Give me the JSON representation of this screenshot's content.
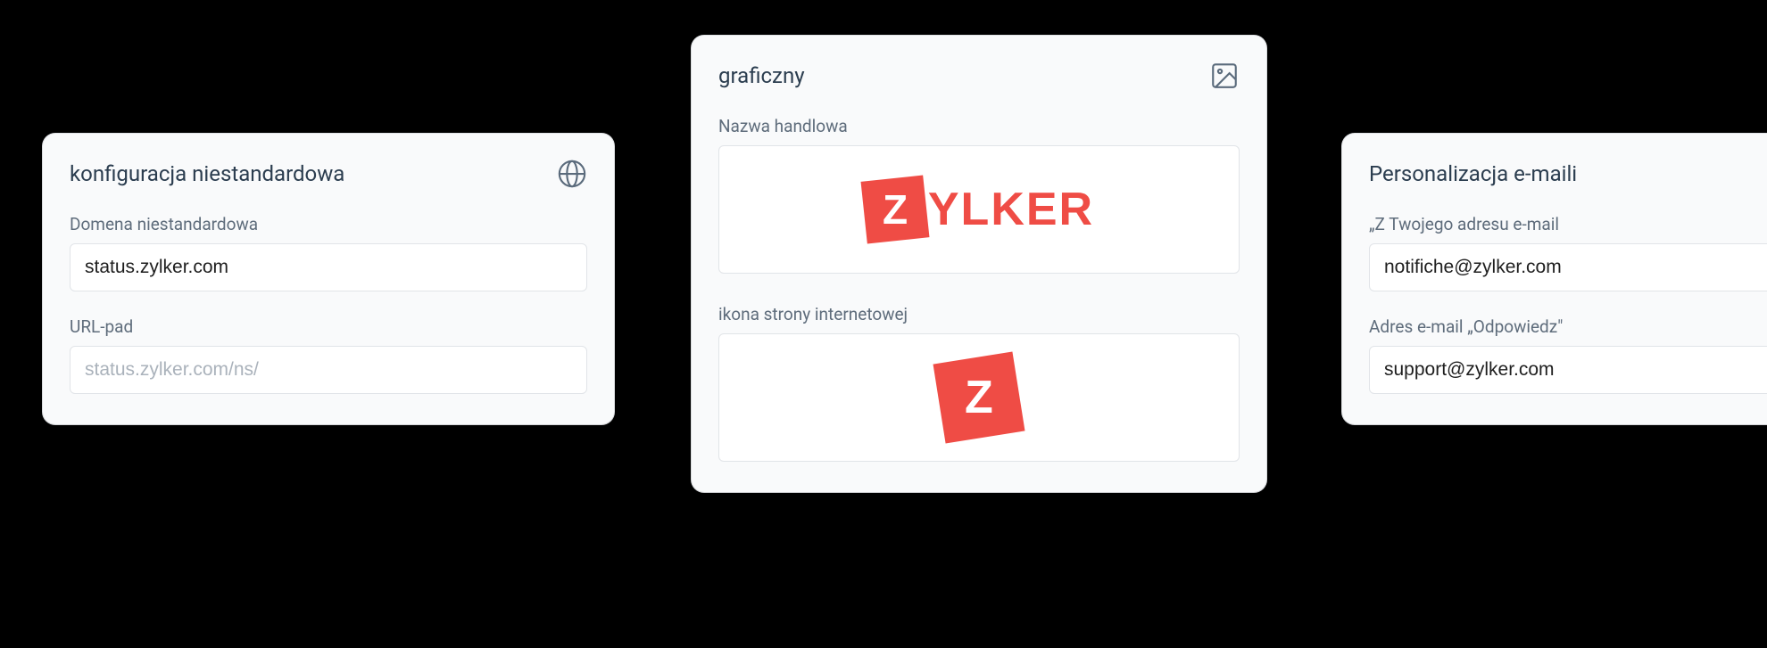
{
  "config": {
    "title": "konfiguracja niestandardowa",
    "domain_label": "Domena niestandardowa",
    "domain_value": "status.zylker.com",
    "urlpad_label": "URL-pad",
    "urlpad_placeholder": "status.zylker.com/ns/"
  },
  "graphic": {
    "title": "graficzny",
    "tradename_label": "Nazwa handlowa",
    "favicon_label": "ikona strony internetowej",
    "brand_text": "YLKER",
    "brand_letter": "Z"
  },
  "email": {
    "title": "Personalizacja e-maili",
    "from_label": "„Z Twojego adresu e-mail",
    "from_value": "notifiche@zylker.com",
    "reply_label": "Adres e-mail „Odpowiedz\"",
    "reply_value": "support@zylker.com"
  }
}
